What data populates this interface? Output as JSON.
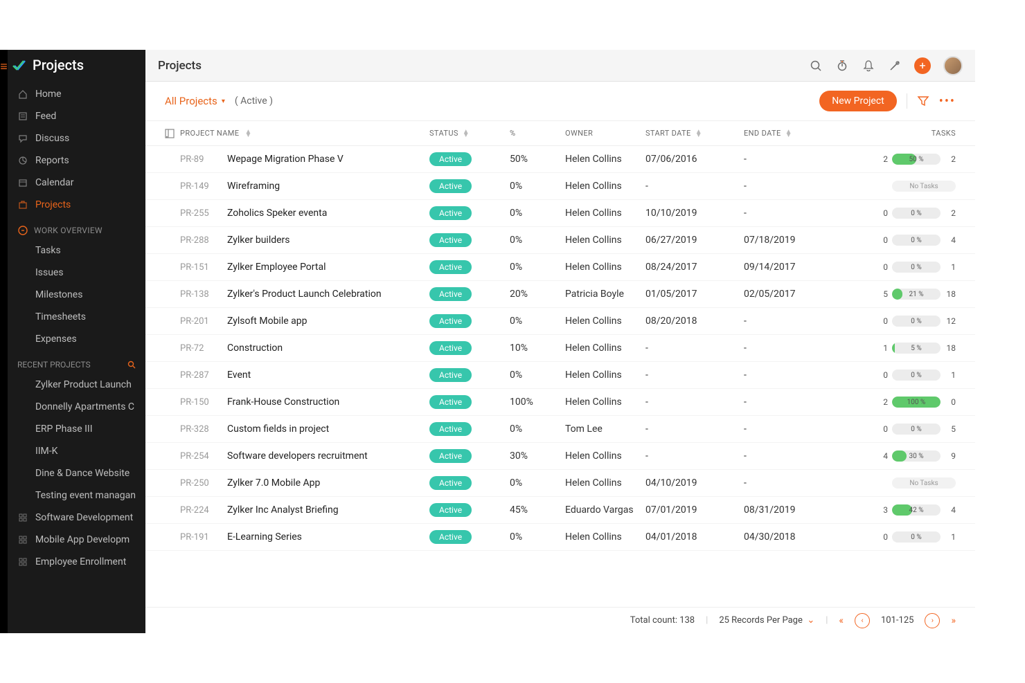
{
  "brand": "Projects",
  "sidebar": {
    "nav": [
      {
        "label": "Home"
      },
      {
        "label": "Feed"
      },
      {
        "label": "Discuss"
      },
      {
        "label": "Reports"
      },
      {
        "label": "Calendar"
      },
      {
        "label": "Projects",
        "active": true
      }
    ],
    "work_overview_title": "WORK OVERVIEW",
    "work_items": [
      {
        "label": "Tasks"
      },
      {
        "label": "Issues"
      },
      {
        "label": "Milestones"
      },
      {
        "label": "Timesheets"
      },
      {
        "label": "Expenses"
      }
    ],
    "recent_title": "RECENT PROJECTS",
    "recent": [
      {
        "label": "Zylker Product Launch"
      },
      {
        "label": "Donnelly Apartments C"
      },
      {
        "label": "ERP Phase III"
      },
      {
        "label": "IIM-K"
      },
      {
        "label": "Dine & Dance Website"
      },
      {
        "label": "Testing event managan"
      }
    ],
    "recent_iconed": [
      {
        "label": "Software Development"
      },
      {
        "label": "Mobile App Developm"
      },
      {
        "label": "Employee Enrollment"
      }
    ]
  },
  "header": {
    "title": "Projects"
  },
  "filterbar": {
    "all_label": "All Projects",
    "active_label": "( Active )",
    "new_project": "New Project"
  },
  "columns": {
    "name": "PROJECT NAME",
    "status": "STATUS",
    "percent": "%",
    "owner": "OWNER",
    "start": "START DATE",
    "end": "END DATE",
    "tasks": "TASKS"
  },
  "status_text": "Active",
  "no_tasks_text": "No Tasks",
  "rows": [
    {
      "code": "PR-89",
      "name": "Wepage Migration Phase V",
      "percent": "50%",
      "owner": "Helen Collins",
      "start": "07/06/2016",
      "end": "-",
      "tleft": 2,
      "tpct": "50 %",
      "tfill": 50,
      "tright": 2
    },
    {
      "code": "PR-149",
      "name": "Wireframing",
      "percent": "0%",
      "owner": "Helen Collins",
      "start": "-",
      "end": "-",
      "no_tasks": true
    },
    {
      "code": "PR-255",
      "name": "Zoholics Speker eventa",
      "percent": "0%",
      "owner": "Helen Collins",
      "start": "10/10/2019",
      "end": "-",
      "tleft": 0,
      "tpct": "0 %",
      "tfill": 0,
      "tright": 2
    },
    {
      "code": "PR-288",
      "name": "Zylker builders",
      "percent": "0%",
      "owner": "Helen Collins",
      "start": "06/27/2019",
      "end": "07/18/2019",
      "tleft": 0,
      "tpct": "0 %",
      "tfill": 0,
      "tright": 4
    },
    {
      "code": "PR-151",
      "name": "Zylker Employee Portal",
      "percent": "0%",
      "owner": "Helen Collins",
      "start": "08/24/2017",
      "end": "09/14/2017",
      "tleft": 0,
      "tpct": "0 %",
      "tfill": 0,
      "tright": 1
    },
    {
      "code": "PR-138",
      "name": "Zylker's Product Launch Celebration",
      "percent": "20%",
      "owner": "Patricia Boyle",
      "start": "01/05/2017",
      "end": "02/05/2017",
      "tleft": 5,
      "tpct": "21 %",
      "tfill": 21,
      "tright": 18
    },
    {
      "code": "PR-201",
      "name": "Zylsoft Mobile app",
      "percent": "0%",
      "owner": "Helen Collins",
      "start": "08/20/2018",
      "end": "-",
      "tleft": 0,
      "tpct": "0 %",
      "tfill": 0,
      "tright": 12
    },
    {
      "code": "PR-72",
      "name": "Construction",
      "percent": "10%",
      "owner": "Helen Collins",
      "start": "-",
      "end": "-",
      "tleft": 1,
      "tpct": "5 %",
      "tfill": 5,
      "tright": 18
    },
    {
      "code": "PR-287",
      "name": "Event",
      "percent": "0%",
      "owner": "Helen Collins",
      "start": "-",
      "end": "-",
      "tleft": 0,
      "tpct": "0 %",
      "tfill": 0,
      "tright": 1
    },
    {
      "code": "PR-150",
      "name": "Frank-House Construction",
      "percent": "100%",
      "owner": "Helen Collins",
      "start": "-",
      "end": "-",
      "tleft": 2,
      "tpct": "100 %",
      "tfill": 100,
      "tright": 0
    },
    {
      "code": "PR-328",
      "name": "Custom fields in project",
      "percent": "0%",
      "owner": "Tom Lee",
      "start": "-",
      "end": "-",
      "tleft": 0,
      "tpct": "0 %",
      "tfill": 0,
      "tright": 5
    },
    {
      "code": "PR-254",
      "name": "Software developers recruitment",
      "percent": "30%",
      "owner": "Helen Collins",
      "start": "-",
      "end": "-",
      "tleft": 4,
      "tpct": "30 %",
      "tfill": 30,
      "tright": 9
    },
    {
      "code": "PR-250",
      "name": "Zylker 7.0 Mobile App",
      "percent": "0%",
      "owner": "Helen Collins",
      "start": "04/10/2019",
      "end": "-",
      "no_tasks": true
    },
    {
      "code": "PR-224",
      "name": "Zylker Inc Analyst Briefing",
      "percent": "45%",
      "owner": "Eduardo Vargas",
      "start": "07/01/2019",
      "end": "08/31/2019",
      "tleft": 3,
      "tpct": "42 %",
      "tfill": 42,
      "tright": 4
    },
    {
      "code": "PR-191",
      "name": "E-Learning Series",
      "percent": "0%",
      "owner": "Helen Collins",
      "start": "04/01/2018",
      "end": "04/30/2018",
      "tleft": 0,
      "tpct": "0 %",
      "tfill": 0,
      "tright": 1
    }
  ],
  "footer": {
    "total": "Total count: 138",
    "perpage": "25 Records Per Page",
    "range": "101-125"
  }
}
